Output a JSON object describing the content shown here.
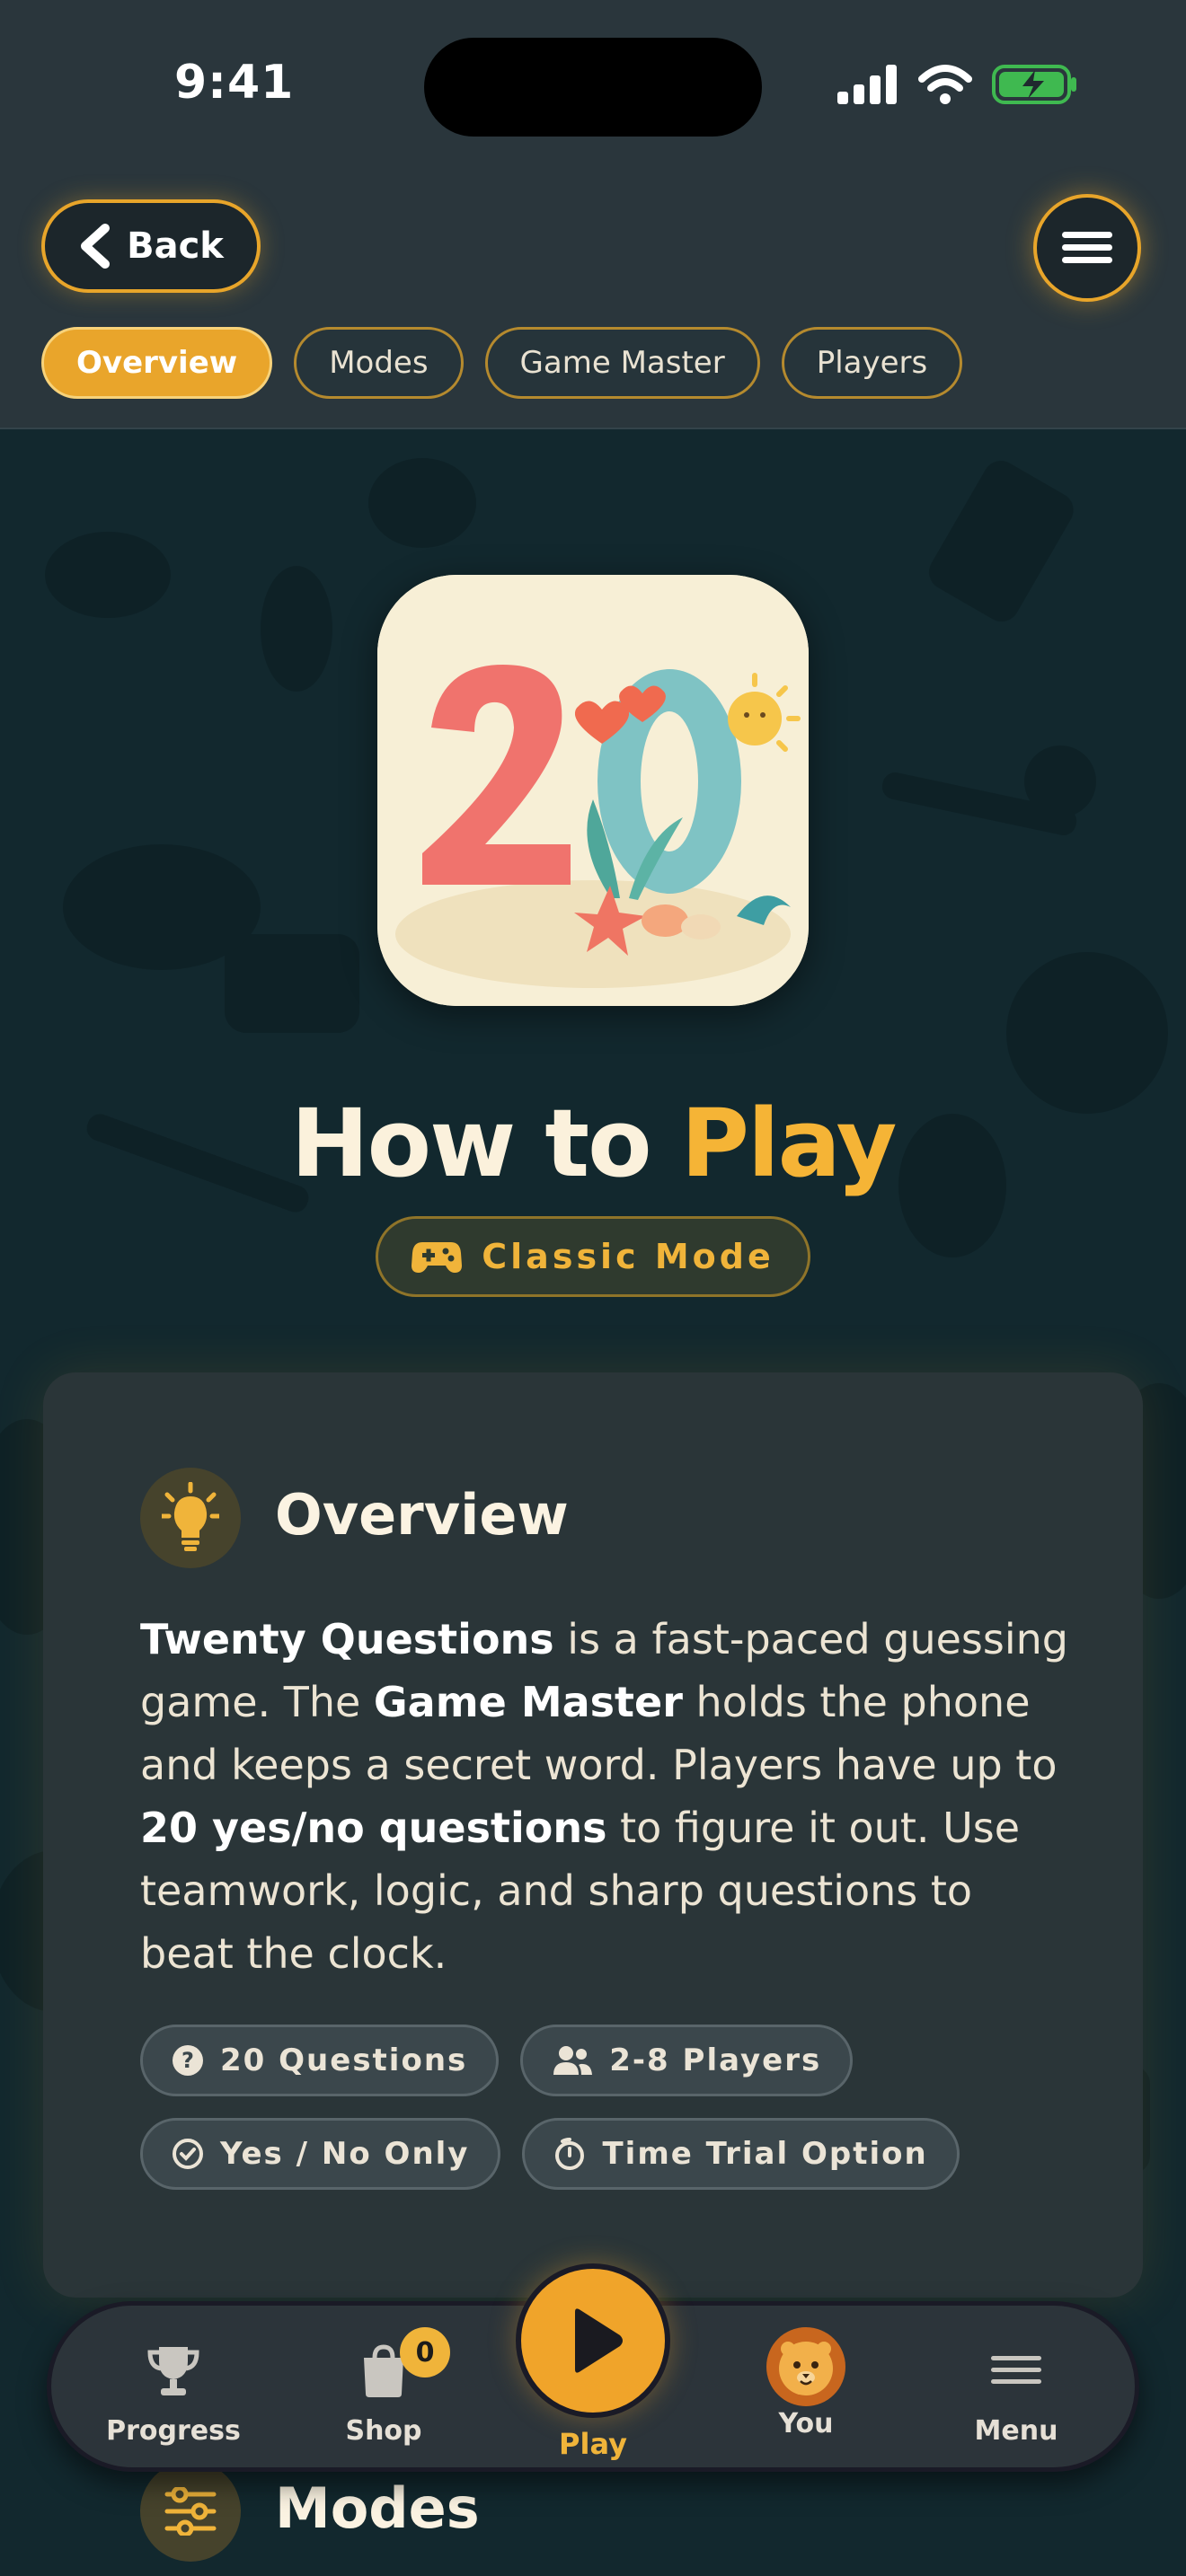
{
  "status_bar": {
    "time": "9:41"
  },
  "header": {
    "back_label": "Back",
    "tabs": [
      {
        "label": "Overview",
        "active": true
      },
      {
        "label": "Modes",
        "active": false
      },
      {
        "label": "Game Master",
        "active": false
      },
      {
        "label": "Players",
        "active": false
      }
    ]
  },
  "hero": {
    "title_part1": "How to",
    "title_part2": "Play",
    "mode_label": "Classic Mode"
  },
  "overview": {
    "heading": "Overview",
    "paragraph": [
      {
        "text": "Twenty Questions",
        "bold": true
      },
      {
        "text": " is a fast-paced guessing game. The ",
        "bold": false
      },
      {
        "text": "Game Master",
        "bold": true
      },
      {
        "text": " holds the phone and keeps a secret word. Players have up to ",
        "bold": false
      },
      {
        "text": "20 yes/no questions",
        "bold": true
      },
      {
        "text": " to figure it out. Use teamwork, logic, and sharp questions to beat the clock.",
        "bold": false
      }
    ],
    "chips": [
      {
        "label": "20 Questions",
        "icon": "question-circle-icon"
      },
      {
        "label": "2-8 Players",
        "icon": "people-icon"
      },
      {
        "label": "Yes / No Only",
        "icon": "check-circle-icon"
      },
      {
        "label": "Time Trial Option",
        "icon": "timer-icon"
      }
    ]
  },
  "modes_section": {
    "heading": "Modes"
  },
  "bottom_nav": {
    "items": [
      {
        "label": "Progress",
        "icon": "trophy-icon"
      },
      {
        "label": "Shop",
        "icon": "shopping-bag-icon",
        "badge": "0"
      },
      {
        "label": "Play",
        "icon": "play-icon"
      },
      {
        "label": "You",
        "icon": "lion-avatar-icon"
      },
      {
        "label": "Menu",
        "icon": "menu-icon"
      }
    ]
  },
  "colors": {
    "accent": "#f0b43a",
    "background": "#12282e",
    "card": "#2a3538",
    "header": "#2a363c"
  }
}
